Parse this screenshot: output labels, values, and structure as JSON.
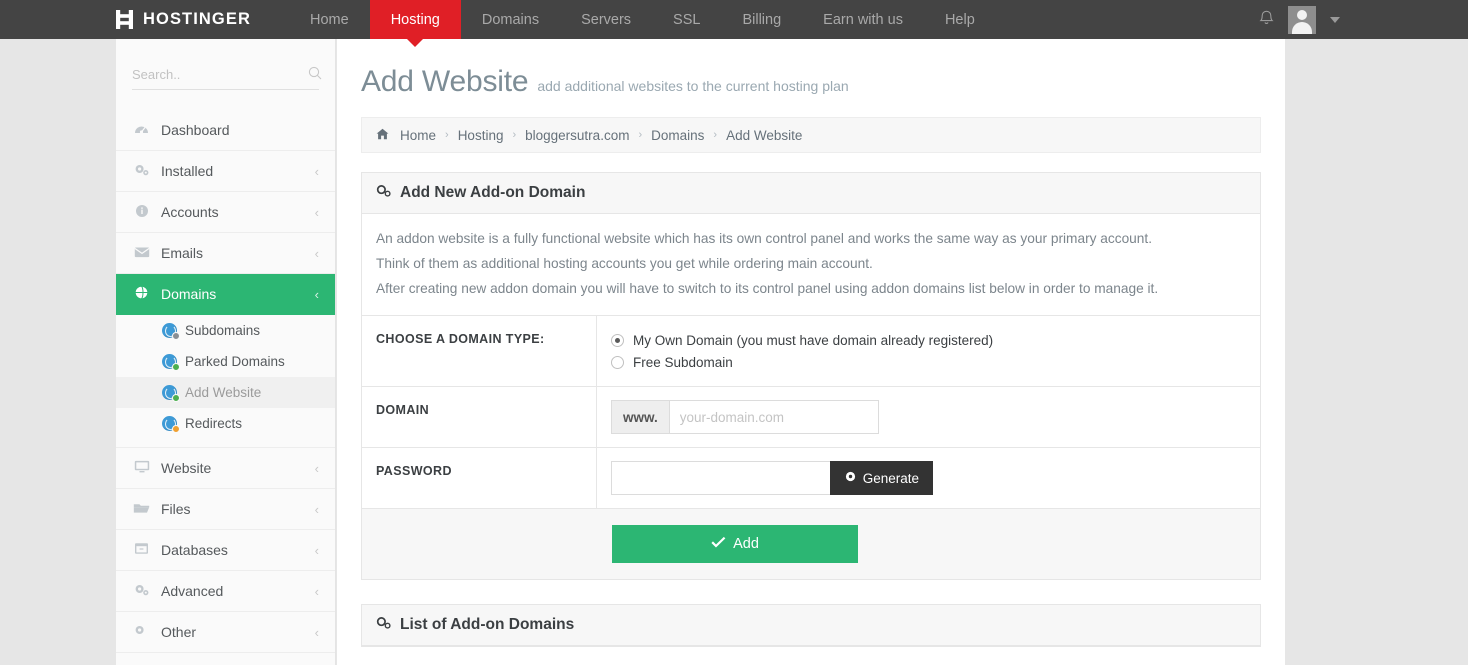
{
  "topnav": {
    "brand": "HOSTINGER",
    "brand_icon": "hostinger-h-logo",
    "items": [
      {
        "label": "Home",
        "active": false
      },
      {
        "label": "Hosting",
        "active": true
      },
      {
        "label": "Domains",
        "active": false
      },
      {
        "label": "Servers",
        "active": false
      },
      {
        "label": "SSL",
        "active": false
      },
      {
        "label": "Billing",
        "active": false
      },
      {
        "label": "Earn with us",
        "active": false
      },
      {
        "label": "Help",
        "active": false
      }
    ],
    "bell_icon": "notification-bell-icon",
    "avatar_icon": "user-avatar",
    "caret_icon": "chevron-down-icon",
    "active_color": "#e01f26",
    "bar_color": "#444444"
  },
  "sidebar": {
    "search": {
      "placeholder": "Search..",
      "value": "",
      "icon": "search-icon"
    },
    "items": [
      {
        "label": "Dashboard",
        "icon": "dashboard-icon",
        "glyph": "◔",
        "chevron": "",
        "active": false
      },
      {
        "label": "Installed",
        "icon": "gears-icon",
        "glyph": "⚙",
        "chevron": "‹",
        "active": false
      },
      {
        "label": "Accounts",
        "icon": "info-icon",
        "glyph": "ℹ",
        "chevron": "‹",
        "active": false
      },
      {
        "label": "Emails",
        "icon": "envelope-icon",
        "glyph": "✉",
        "chevron": "‹",
        "active": false
      },
      {
        "label": "Domains",
        "icon": "globe-icon",
        "glyph": "●",
        "chevron": "‹",
        "active": true
      }
    ],
    "subitems": [
      {
        "label": "Subdomains",
        "icon": "globe-gear-icon",
        "badge": "gray",
        "current": false
      },
      {
        "label": "Parked Domains",
        "icon": "globe-check-icon",
        "badge": "green",
        "current": false
      },
      {
        "label": "Add Website",
        "icon": "globe-add-icon",
        "badge": "green",
        "current": true
      },
      {
        "label": "Redirects",
        "icon": "globe-redirect-icon",
        "badge": "orange",
        "current": false
      }
    ],
    "items_after": [
      {
        "label": "Website",
        "icon": "monitor-icon",
        "glyph": "▭",
        "chevron": "‹",
        "active": false
      },
      {
        "label": "Files",
        "icon": "folder-icon",
        "glyph": "▱",
        "chevron": "‹",
        "active": false
      },
      {
        "label": "Databases",
        "icon": "database-icon",
        "glyph": "▤",
        "chevron": "‹",
        "active": false
      },
      {
        "label": "Advanced",
        "icon": "gears-icon",
        "glyph": "⚙",
        "chevron": "‹",
        "active": false
      },
      {
        "label": "Other",
        "icon": "other-icon",
        "glyph": "⚙",
        "chevron": "‹",
        "active": false
      }
    ],
    "active_color": "#2cb673"
  },
  "header": {
    "title": "Add Website",
    "subtitle": "add additional websites to the current hosting plan"
  },
  "breadcrumb": {
    "home_icon": "home-icon",
    "items": [
      "Home",
      "Hosting",
      "bloggersutra.com",
      "Domains",
      "Add Website"
    ],
    "separator": "›"
  },
  "main_panel": {
    "icon": "gears-icon",
    "heading": "Add New Add-on Domain",
    "description": [
      "An addon website is a fully functional website which has its own control panel and works the same way as your primary account.",
      "Think of them as additional hosting accounts you get while ordering main account.",
      "After creating new addon domain you will have to switch to its control panel using addon domains list below in order to manage it."
    ],
    "domain_type": {
      "label": "CHOOSE A DOMAIN TYPE:",
      "options": [
        {
          "label": "My Own Domain (you must have domain already registered)",
          "selected": true
        },
        {
          "label": "Free Subdomain",
          "selected": false
        }
      ]
    },
    "domain": {
      "label": "DOMAIN",
      "prefix": "www.",
      "placeholder": "your-domain.com",
      "value": ""
    },
    "password": {
      "label": "PASSWORD",
      "value": "",
      "placeholder": "",
      "generate_label": "Generate",
      "generate_icon": "gear-icon"
    },
    "submit": {
      "label": "Add",
      "icon": "check-icon",
      "color": "#2cb673"
    }
  },
  "list_panel": {
    "icon": "gears-icon",
    "heading": "List of Add-on Domains"
  }
}
